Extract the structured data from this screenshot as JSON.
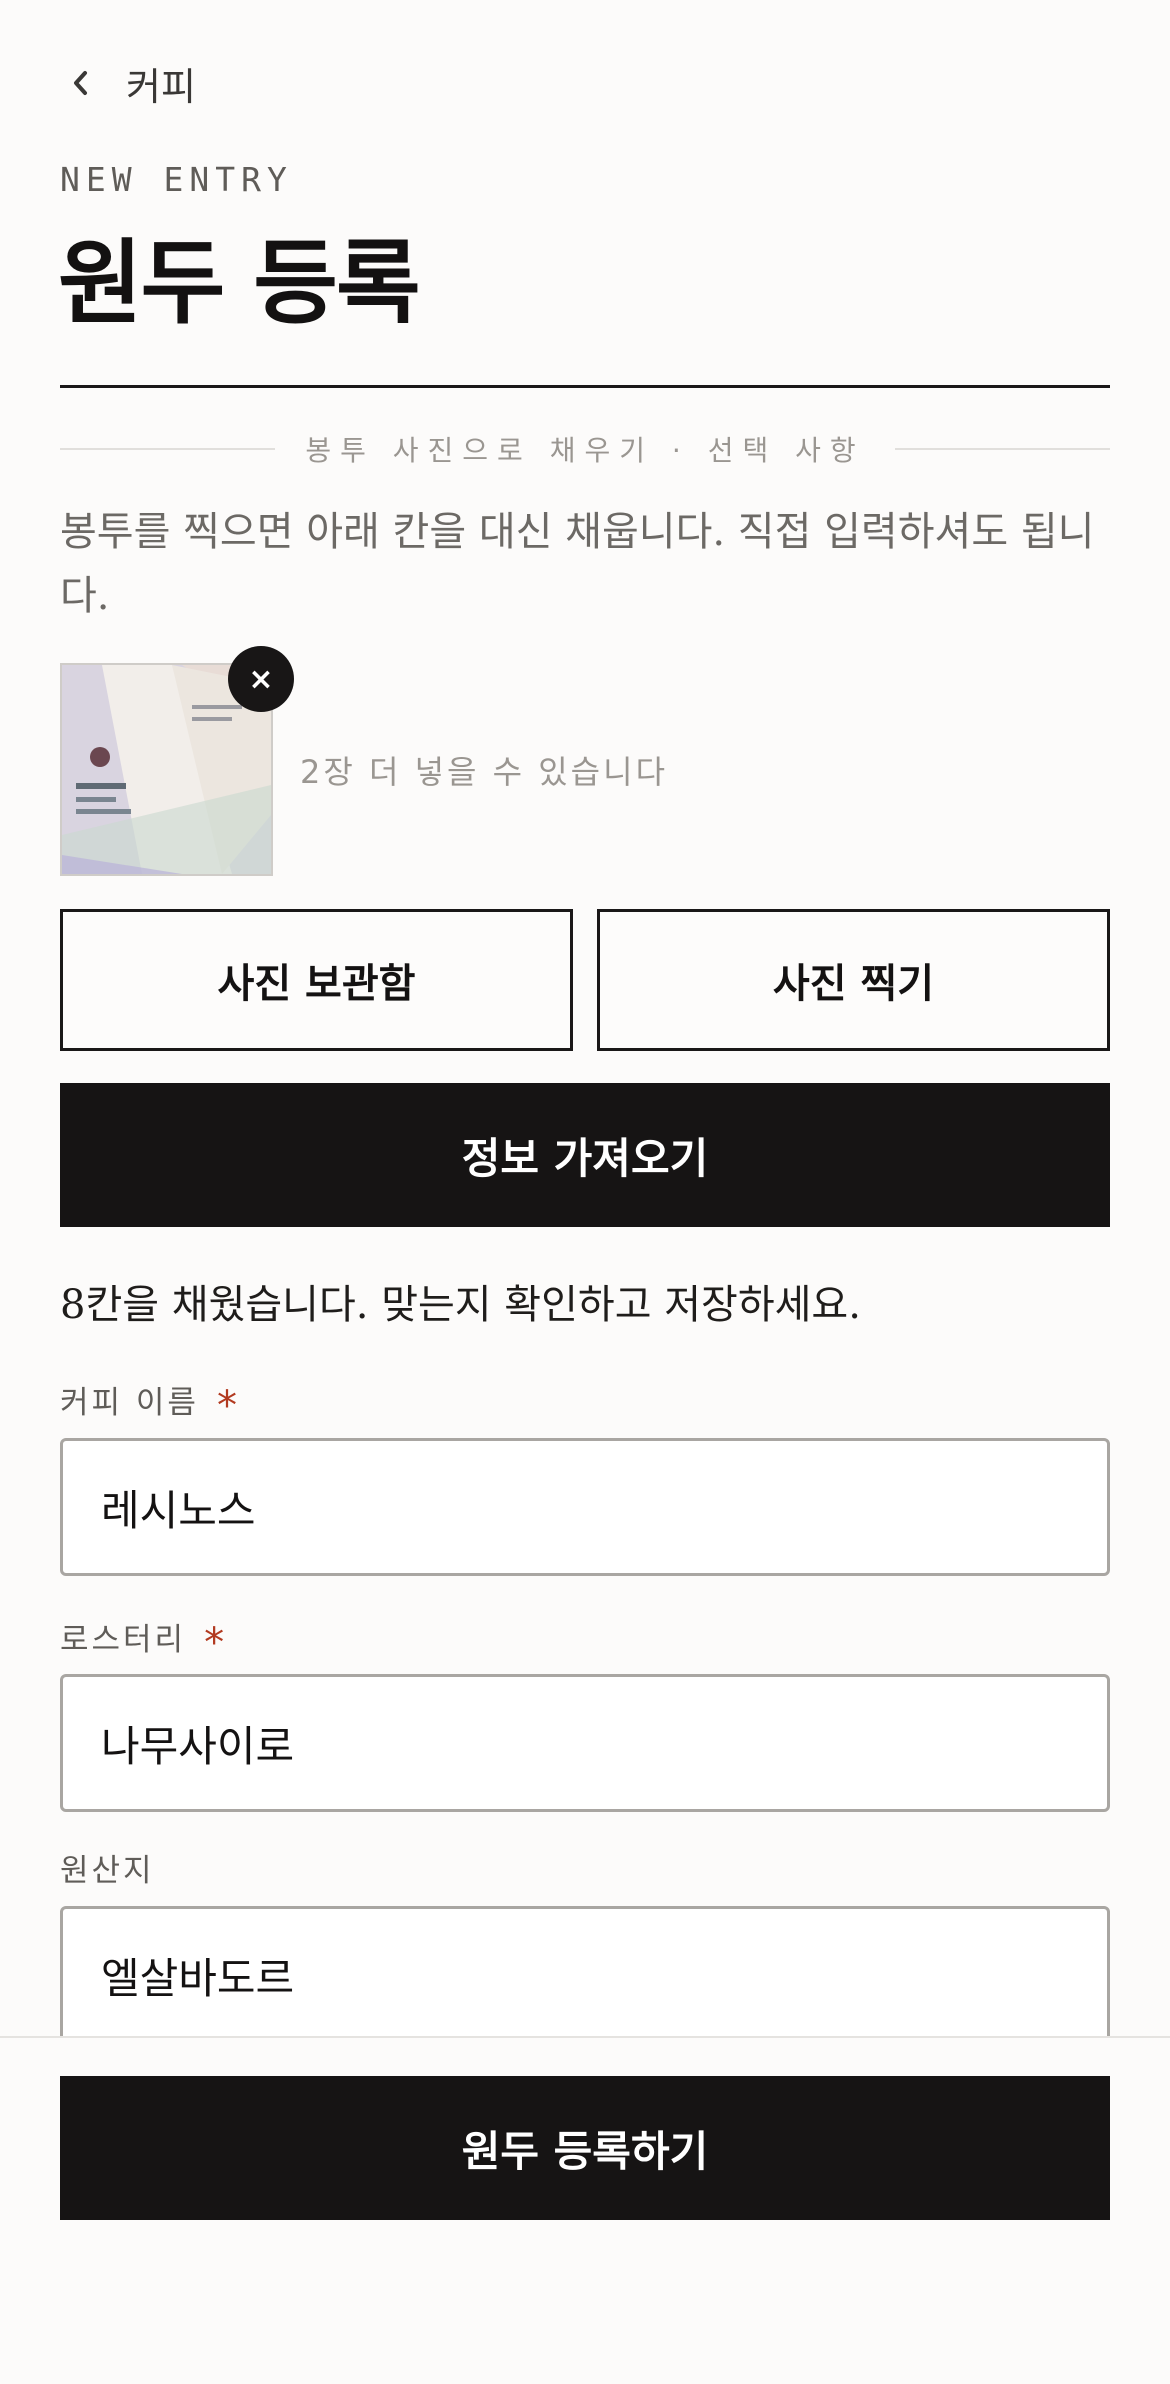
{
  "header": {
    "back_label": "커피"
  },
  "eyebrow": "NEW ENTRY",
  "title": "원두 등록",
  "photo_section": {
    "divider_text": "봉투 사진으로 채우기 · 선택 사항",
    "intro": "봉투를 찍으면 아래 칸을 대신 채웁니다. 직접 입력하셔도 됩니다.",
    "remaining_text": "2장 더 넣을 수 있습니다",
    "remove_label": "×"
  },
  "buttons": {
    "library": "사진 보관함",
    "camera": "사진 찍기",
    "fetch": "정보 가져오기",
    "submit": "원두 등록하기"
  },
  "status": "8칸을 채웠습니다. 맞는지 확인하고 저장하세요.",
  "form": {
    "name": {
      "label": "커피 이름",
      "required_mark": "*",
      "value": "레시노스"
    },
    "roaster": {
      "label": "로스터리",
      "required_mark": "*",
      "value": "나무사이로"
    },
    "origin": {
      "label": "원산지",
      "value": "엘살바도르"
    }
  },
  "colors": {
    "background": "#fcfbfa",
    "primary": "#161414",
    "required": "#b23a20",
    "muted_text": "#9a9691"
  },
  "icons": {
    "back": "chevron-left-icon",
    "remove": "close-icon"
  }
}
